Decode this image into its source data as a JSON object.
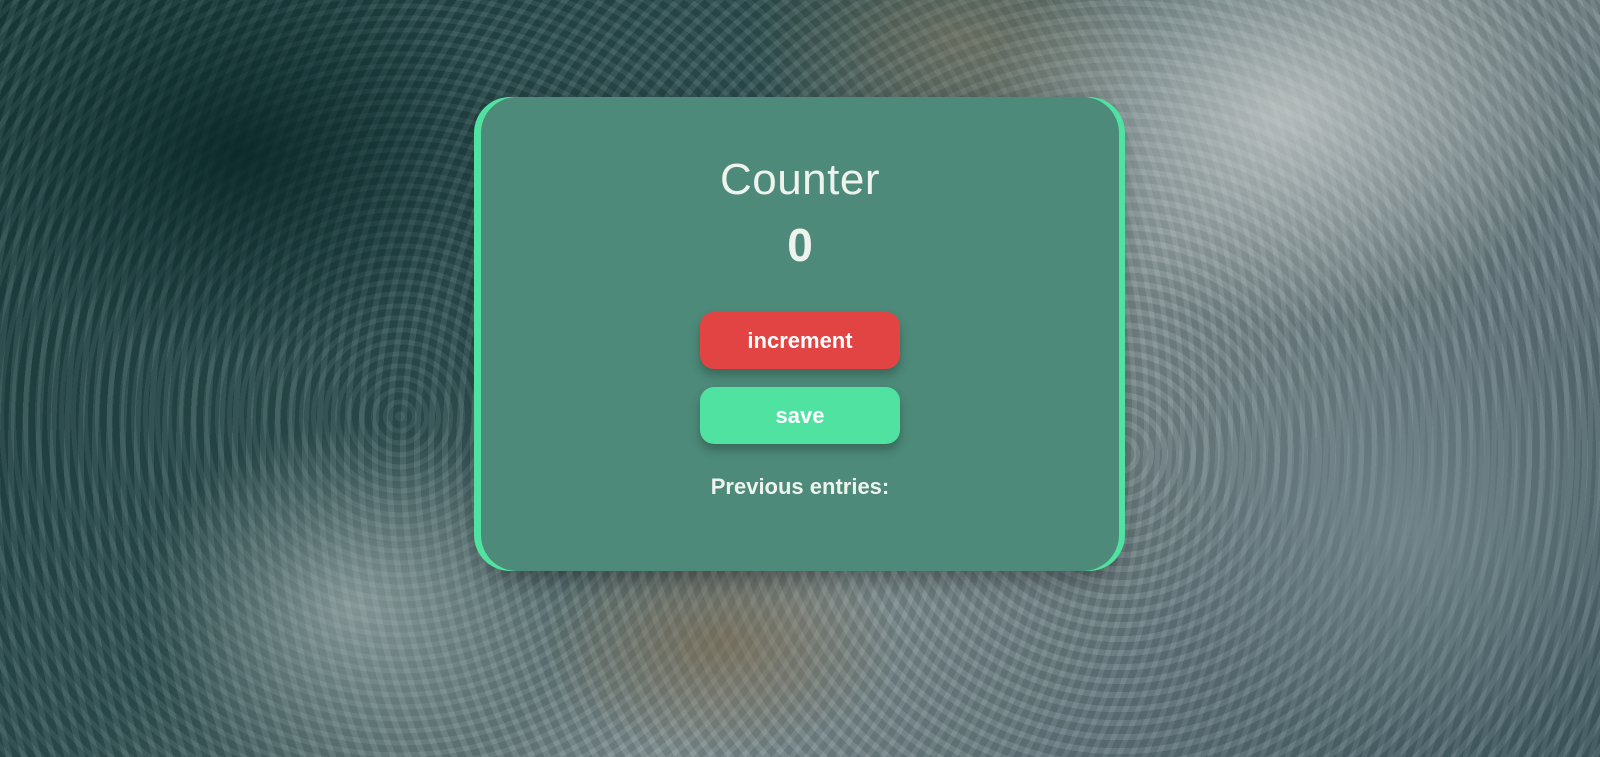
{
  "counter": {
    "title": "Counter",
    "value": "0",
    "increment_label": "increment",
    "save_label": "save",
    "entries_label": "Previous entries:"
  },
  "colors": {
    "card": "#4d8a79",
    "card_edge": "#4fe2a1",
    "increment_button": "#e24444",
    "save_button": "#4fe2a1",
    "text": "#eef3ee"
  }
}
